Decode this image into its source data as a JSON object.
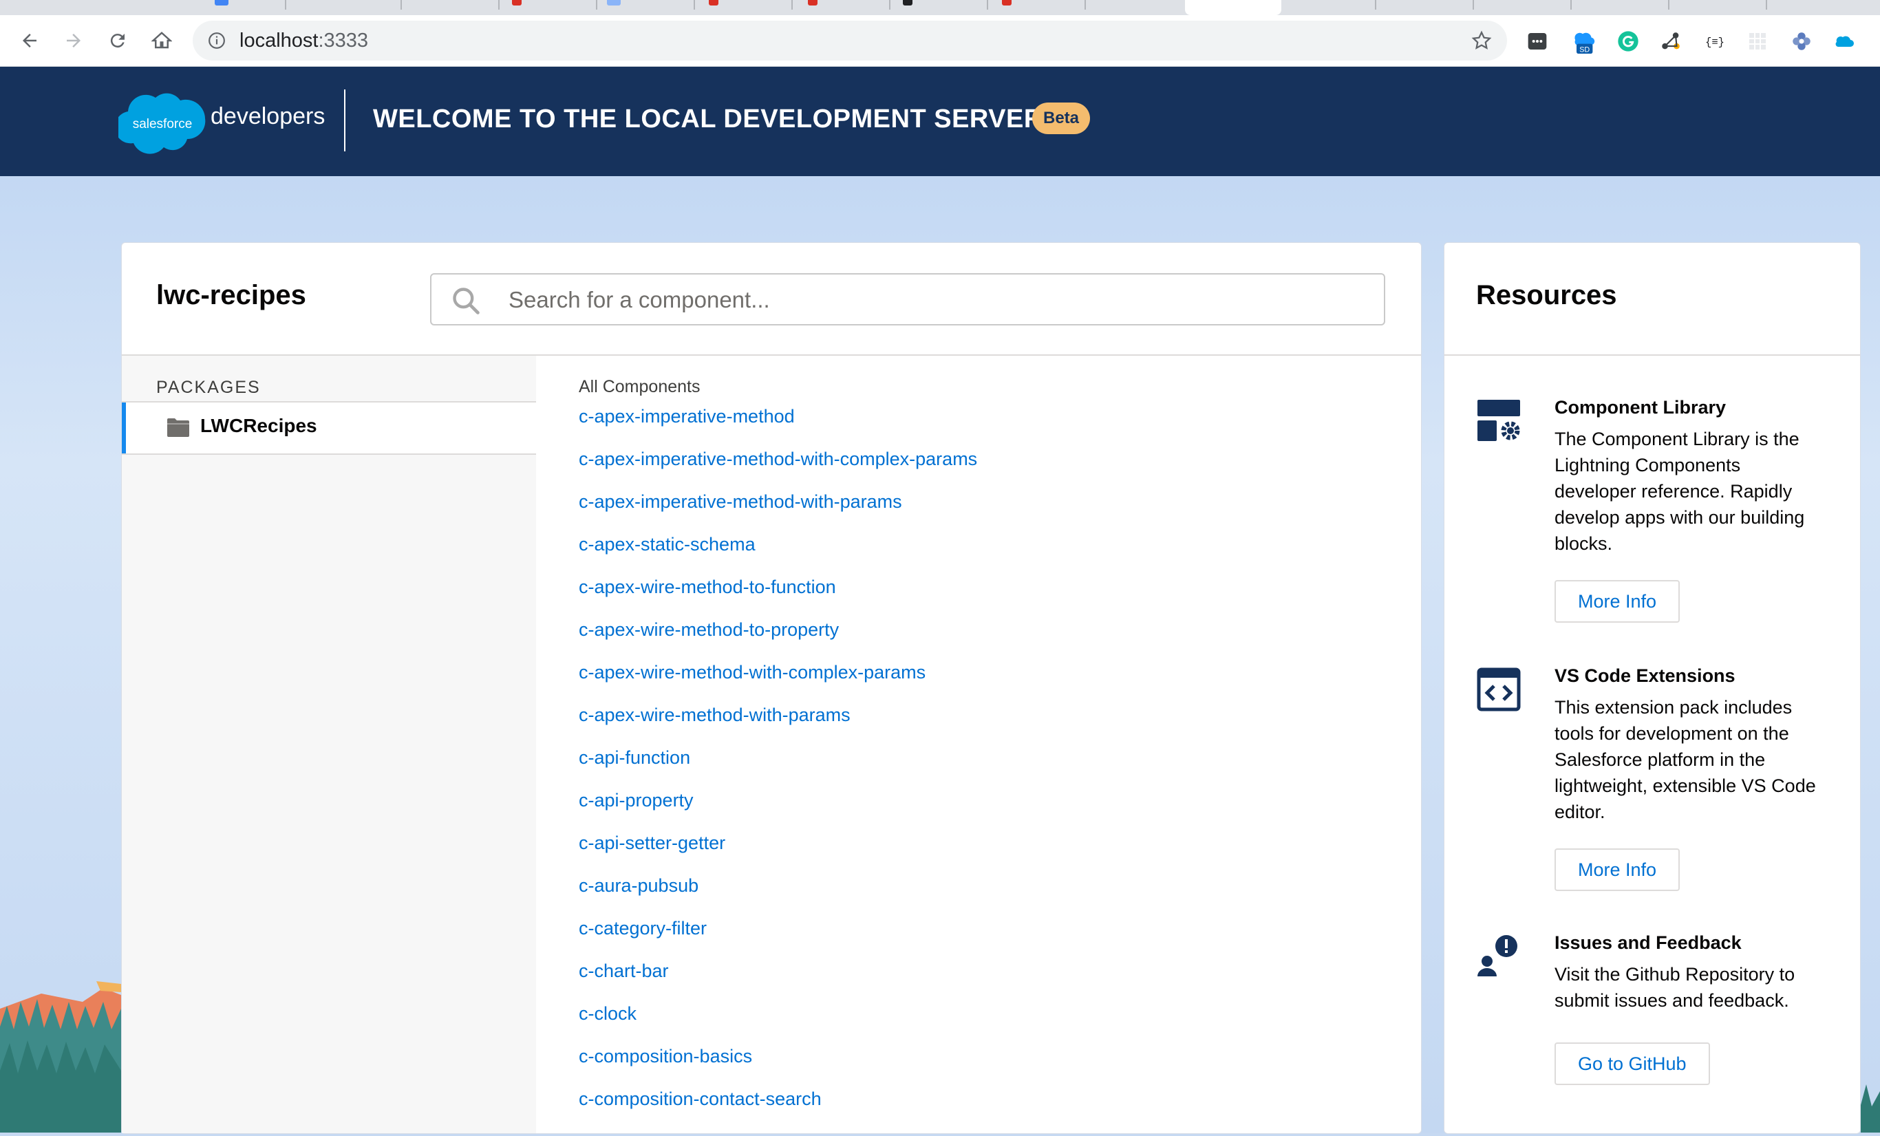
{
  "browser": {
    "url_host": "localhost",
    "url_port": ":3333"
  },
  "header": {
    "logo_brand": "salesforce",
    "logo_word": "developers",
    "title": "WELCOME TO THE LOCAL DEVELOPMENT SERVER",
    "badge": "Beta"
  },
  "main": {
    "project_title": "lwc-recipes",
    "search_placeholder": "Search for a component...",
    "packages_heading": "PACKAGES",
    "packages": [
      {
        "label": "LWCRecipes",
        "selected": true
      }
    ],
    "components_heading": "All Components",
    "components": [
      "c-apex-imperative-method",
      "c-apex-imperative-method-with-complex-params",
      "c-apex-imperative-method-with-params",
      "c-apex-static-schema",
      "c-apex-wire-method-to-function",
      "c-apex-wire-method-to-property",
      "c-apex-wire-method-with-complex-params",
      "c-apex-wire-method-with-params",
      "c-api-function",
      "c-api-property",
      "c-api-setter-getter",
      "c-aura-pubsub",
      "c-category-filter",
      "c-chart-bar",
      "c-clock",
      "c-composition-basics",
      "c-composition-contact-search"
    ]
  },
  "resources": {
    "title": "Resources",
    "items": [
      {
        "icon": "component-library-icon",
        "heading": "Component Library",
        "description": "The Component Library is the Lightning Components developer reference. Rapidly develop apps with our building blocks.",
        "button": "More Info"
      },
      {
        "icon": "code-window-icon",
        "heading": "VS Code Extensions",
        "description": "This extension pack includes tools for development on the Salesforce platform in the lightweight, extensible VS Code editor.",
        "button": "More Info"
      },
      {
        "icon": "feedback-user-icon",
        "heading": "Issues and Feedback",
        "description": "Visit the Github Repository to submit issues and feedback.",
        "button": "Go to GitHub"
      }
    ]
  },
  "colors": {
    "header_bg": "#16325c",
    "link": "#0070d2",
    "badge_bg": "#f4bc6e",
    "selected_bar": "#1589ee"
  }
}
